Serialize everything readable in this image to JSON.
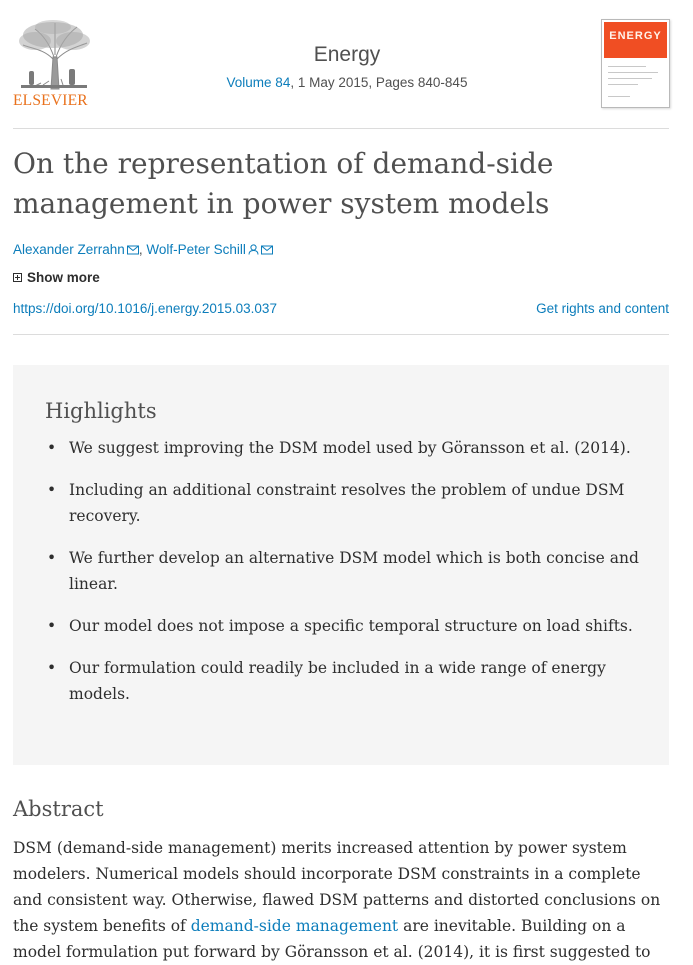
{
  "header": {
    "publisher": "ELSEVIER",
    "journal_title": "Energy",
    "volume_link": "Volume 84",
    "issue_rest": ", 1 May 2015, Pages 840-845",
    "cover_title": "ENERGY"
  },
  "article": {
    "title": "On the representation of demand-side management in power system models",
    "authors": [
      {
        "name": "Alexander Zerrahn",
        "icons": [
          "mail-icon"
        ]
      },
      {
        "name": "Wolf-Peter Schill",
        "icons": [
          "person-icon",
          "mail-icon"
        ]
      }
    ],
    "author_separator": ",",
    "show_more": "Show more",
    "doi": "https://doi.org/10.1016/j.energy.2015.03.037",
    "rights": "Get rights and content"
  },
  "highlights": {
    "heading": "Highlights",
    "bullet": "•",
    "items": [
      "We suggest improving the DSM model used by Göransson et al. (2014).",
      "Including an additional constraint resolves the problem of undue DSM recovery.",
      "We further develop an alternative DSM model which is both concise and linear.",
      "Our model does not impose a specific temporal structure on load shifts.",
      "Our formulation could readily be included in a wide range of energy models."
    ]
  },
  "abstract": {
    "heading": "Abstract",
    "text_before_link": "DSM (demand-side management) merits increased attention by power system modelers. Numerical models should incorporate DSM constraints in a complete and consistent way. Otherwise, flawed DSM patterns and distorted conclusions on the system benefits of ",
    "link_text": "demand-side management",
    "text_after_link": " are inevitable. Building on a model formulation put forward by Göransson et al. (2014), it is first suggested to"
  },
  "colors": {
    "link": "#0c7dbb",
    "publisher_orange": "#e9711c",
    "cover_red": "#f04e23",
    "highlight_bg": "#f5f5f5"
  }
}
